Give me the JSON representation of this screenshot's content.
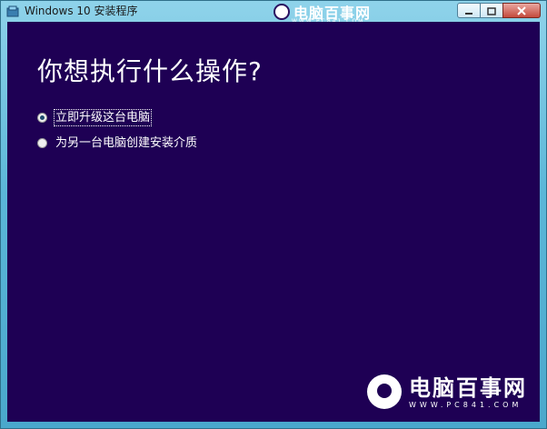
{
  "window": {
    "title": "Windows 10 安装程序",
    "controls": [
      "minimize-icon",
      "maximize-icon",
      "close-icon"
    ]
  },
  "main": {
    "heading": "你想执行什么操作?",
    "options": [
      {
        "label": "立即升级这台电脑",
        "selected": true
      },
      {
        "label": "为另一台电脑创建安装介质",
        "selected": false
      }
    ]
  },
  "watermark": {
    "brand": "电脑百事网",
    "url": "WWW.PC841.COM"
  },
  "colors": {
    "background": "#1e0054",
    "text": "#ffffff",
    "titlebar": "#5bb7d8"
  }
}
